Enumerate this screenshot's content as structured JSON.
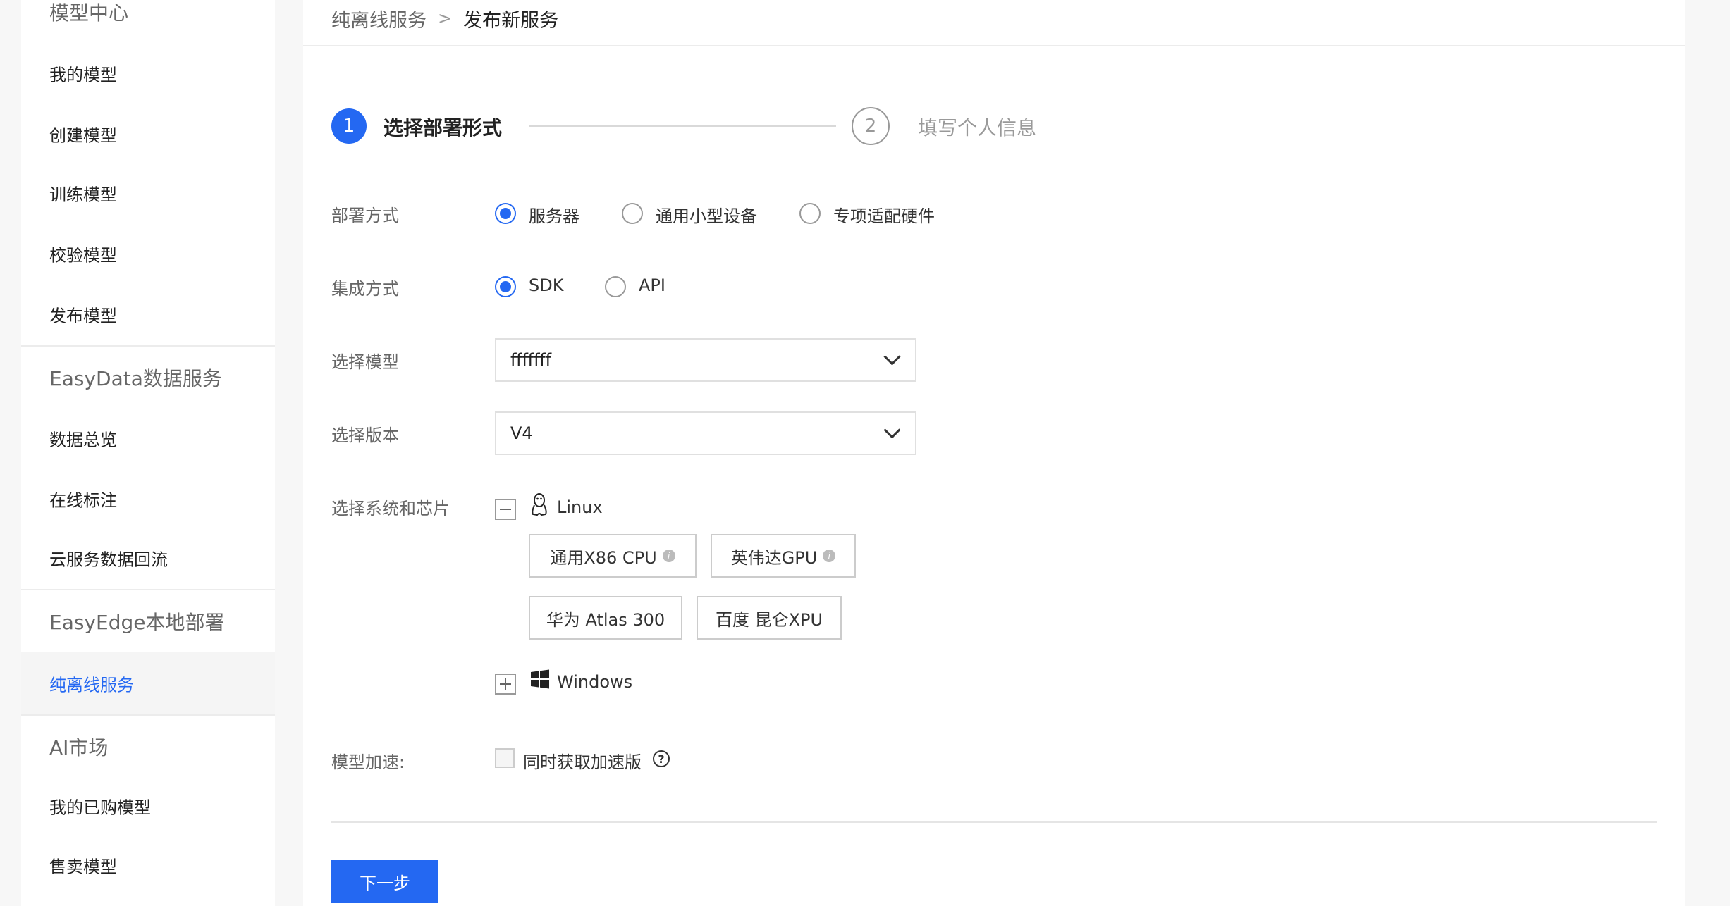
{
  "sidebar": {
    "sections": [
      {
        "title": "模型中心",
        "items": [
          "我的模型",
          "创建模型",
          "训练模型",
          "校验模型",
          "发布模型"
        ]
      },
      {
        "title": "EasyData数据服务",
        "items": [
          "数据总览",
          "在线标注",
          "云服务数据回流"
        ]
      },
      {
        "title": "EasyEdge本地部署",
        "items": [
          "纯离线服务"
        ]
      },
      {
        "title": "AI市场",
        "items": [
          "我的已购模型",
          "售卖模型"
        ]
      }
    ],
    "active_item": "纯离线服务"
  },
  "breadcrumb": {
    "parent": "纯离线服务",
    "separator": ">",
    "current": "发布新服务"
  },
  "steps": [
    {
      "number": "1",
      "label": "选择部署形式",
      "state": "active"
    },
    {
      "number": "2",
      "label": "填写个人信息",
      "state": "inactive"
    }
  ],
  "form": {
    "deploy_method": {
      "label": "部署方式",
      "options": [
        "服务器",
        "通用小型设备",
        "专项适配硬件"
      ],
      "selected": "服务器"
    },
    "integration_method": {
      "label": "集成方式",
      "options": [
        "SDK",
        "API"
      ],
      "selected": "SDK"
    },
    "model_select": {
      "label": "选择模型",
      "value": "fffffff"
    },
    "version_select": {
      "label": "选择版本",
      "value": "V4"
    },
    "system_chip": {
      "label": "选择系统和芯片",
      "linux": {
        "label": "Linux",
        "expanded": true,
        "chips": [
          {
            "label": "通用X86 CPU",
            "info_icon": true
          },
          {
            "label": "英伟达GPU",
            "info_icon": true
          },
          {
            "label": "华为 Atlas 300",
            "info_icon": false
          },
          {
            "label": "百度 昆仑XPU",
            "info_icon": false
          }
        ]
      },
      "windows": {
        "label": "Windows",
        "expanded": false
      }
    },
    "acceleration": {
      "label": "模型加速:",
      "checkbox_label": "同时获取加速版",
      "checked": false
    }
  },
  "next_button_label": "下一步",
  "colors": {
    "accent": "#2468f2",
    "sidebar_bg": "#ffffff",
    "page_bg": "#f7f7f7"
  },
  "icons": {
    "linux": "linux-penguin-icon",
    "windows": "windows-logo-icon",
    "info": "info-icon",
    "help": "question-circle-icon"
  }
}
